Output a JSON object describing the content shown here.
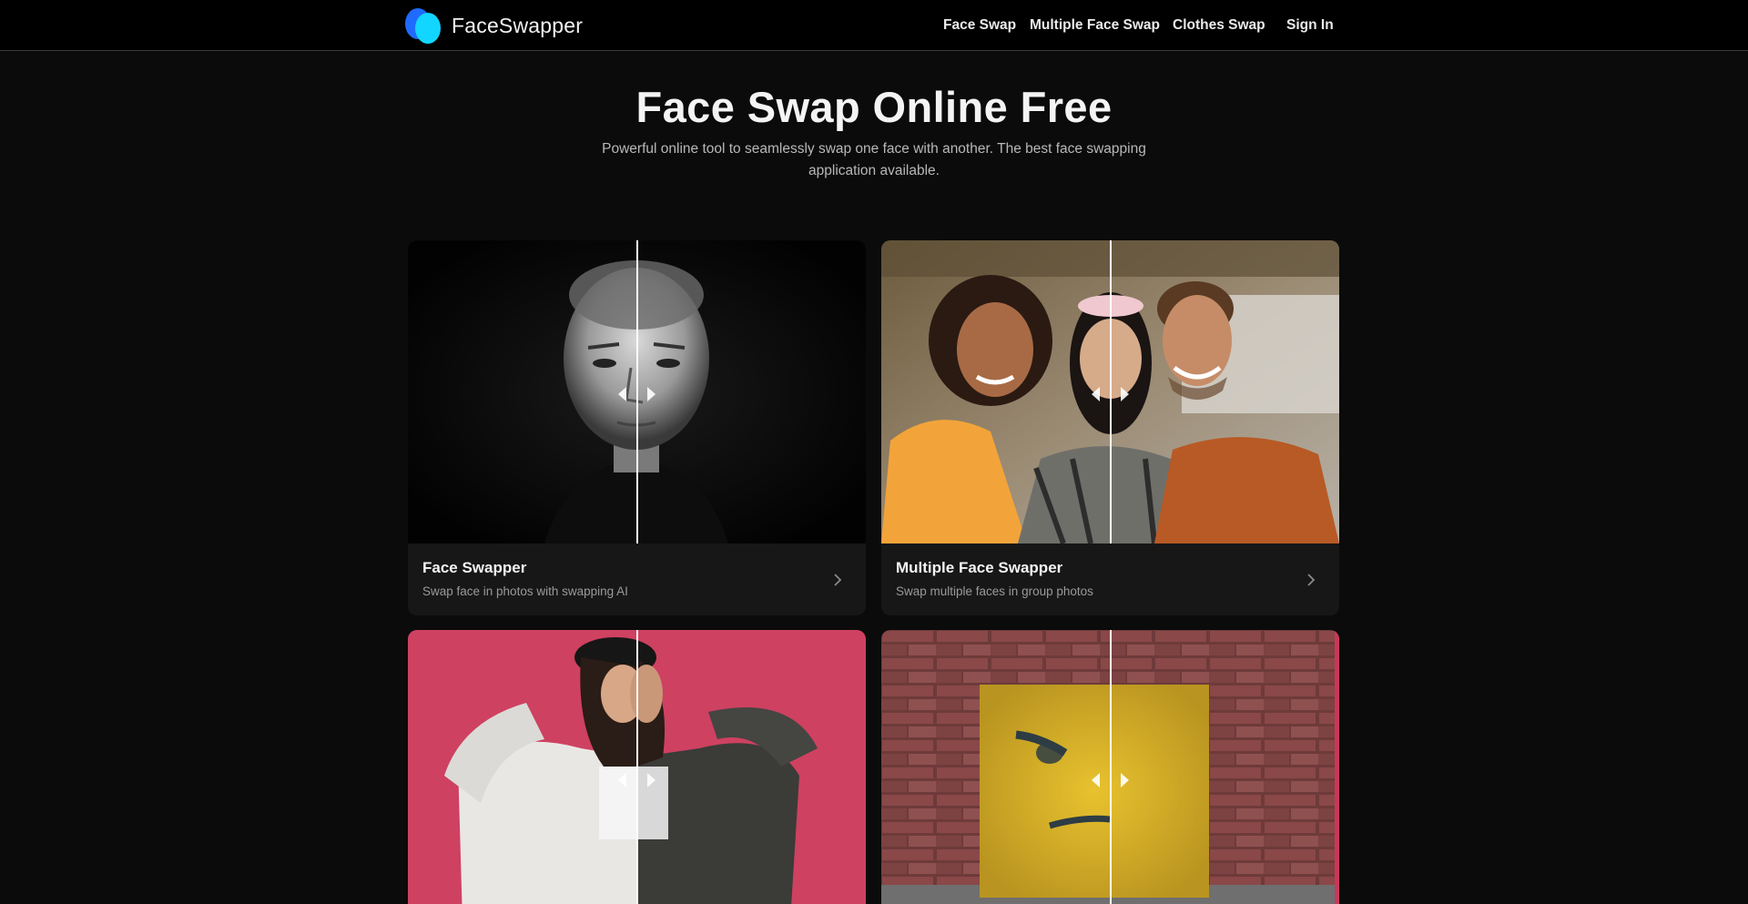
{
  "brand": {
    "name": "FaceSwapper",
    "icon": "overlapping-ovals-logo",
    "colors": [
      "#1f6bff",
      "#12d6ff"
    ]
  },
  "nav": {
    "face_swap": "Face Swap",
    "multiple_face_swap": "Multiple Face Swap",
    "clothes_swap": "Clothes Swap",
    "sign_in": "Sign In"
  },
  "hero": {
    "title": "Face Swap Online Free",
    "subtitle": "Powerful online tool to seamlessly swap one face with another. The best face swapping application available."
  },
  "cards": [
    {
      "title": "Face Swapper",
      "subtitle": "Swap face in photos with swapping AI",
      "icon": "chevron-right-icon"
    },
    {
      "title": "Multiple Face Swapper",
      "subtitle": "Swap multiple faces in group photos",
      "icon": "chevron-right-icon"
    },
    {
      "title": "",
      "subtitle": "",
      "icon": "chevron-right-icon"
    },
    {
      "title": "",
      "subtitle": "",
      "icon": "chevron-right-icon"
    }
  ],
  "theme": {
    "background": "#0b0b0b",
    "header": "#000000",
    "card": "#171717",
    "accent_pink": "#c9385a"
  }
}
